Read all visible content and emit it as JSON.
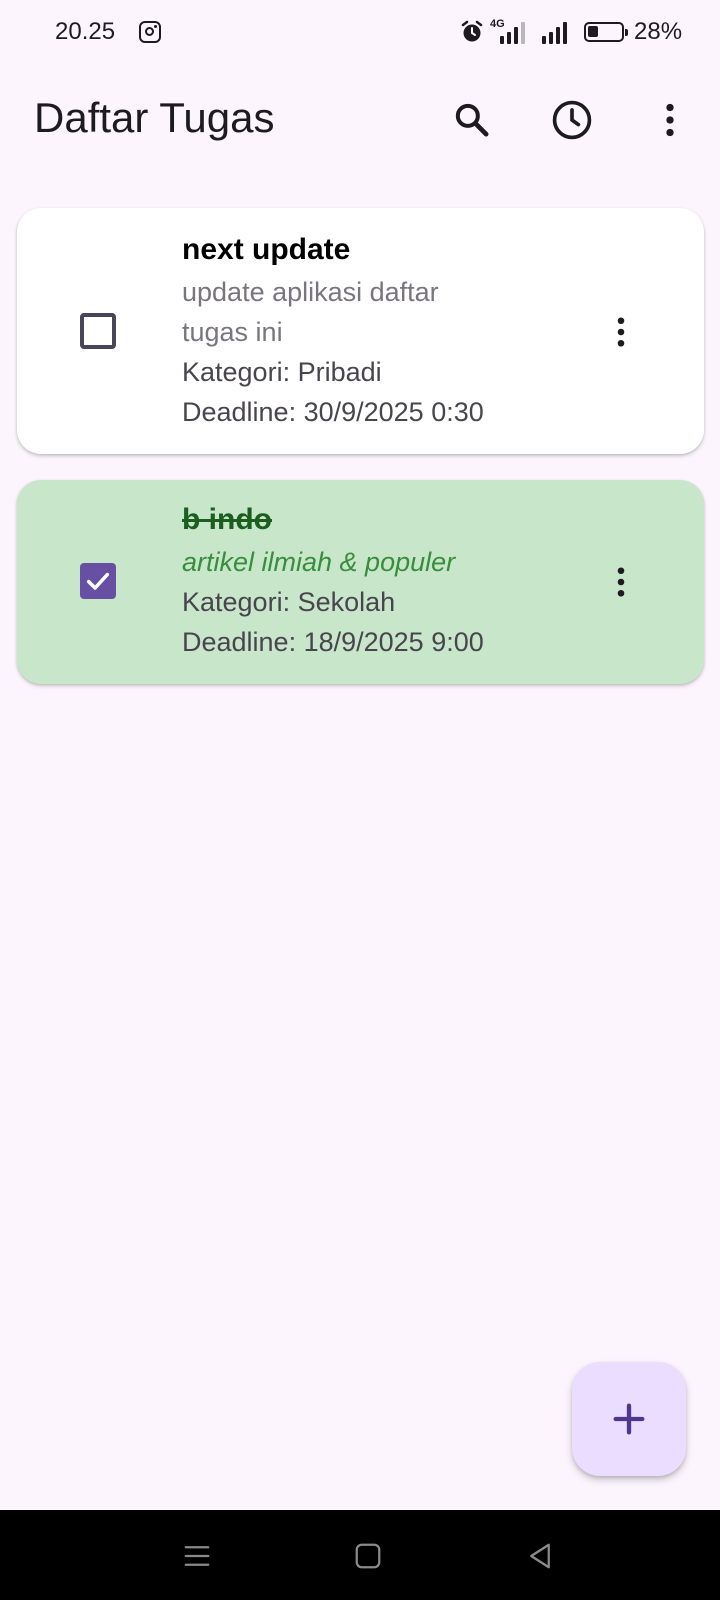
{
  "status_bar": {
    "time": "20.25",
    "network": "4G",
    "battery": "28%",
    "icons": [
      "instagram-icon",
      "alarm-icon",
      "signal-icon",
      "battery-icon"
    ]
  },
  "app_bar": {
    "title": "Daftar Tugas",
    "actions": [
      "search-icon",
      "history-icon",
      "more-vert-icon"
    ]
  },
  "tasks": [
    {
      "title": "next update",
      "description": "update aplikasi daftar tugas ini",
      "category": "Kategori: Pribadi",
      "deadline": "Deadline: 30/9/2025 0:30",
      "completed": false,
      "background": "#ffffff"
    },
    {
      "title": "b indo",
      "description": "artikel ilmiah & populer",
      "category": "Kategori: Sekolah",
      "deadline": "Deadline: 18/9/2025 9:00",
      "completed": true,
      "background": "#c8e6c9"
    }
  ],
  "fab": {
    "icon": "add-icon"
  },
  "nav_bar": {
    "buttons": [
      "menu-icon",
      "home-icon",
      "back-icon"
    ]
  },
  "colors": {
    "background": "#fcf5fd",
    "accent": "#6750a4",
    "fab": "#eaddff",
    "completed_title": "#1b5e20",
    "completed_desc": "#388e3c"
  }
}
